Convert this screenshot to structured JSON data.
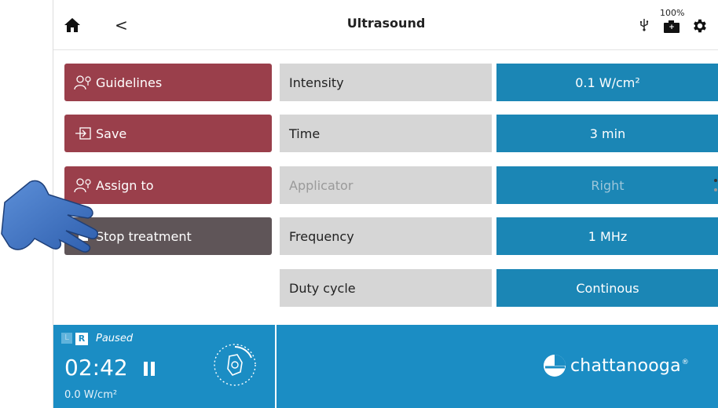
{
  "header": {
    "title": "Ultrasound",
    "back_glyph": "<",
    "battery_percent": "100%",
    "icons": [
      "home-icon",
      "back-icon",
      "usb-icon",
      "battery-icon",
      "gear-icon"
    ]
  },
  "actions": {
    "guidelines": "Guidelines",
    "save": "Save",
    "assign_to": "Assign to",
    "stop_treatment": "Stop treatment"
  },
  "parameters": [
    {
      "label": "Intensity",
      "value": "0.1 W/cm²",
      "enabled": true
    },
    {
      "label": "Time",
      "value": "3 min",
      "enabled": true
    },
    {
      "label": "Applicator",
      "value": "Right",
      "enabled": false
    },
    {
      "label": "Frequency",
      "value": "1 MHz",
      "enabled": true
    },
    {
      "label": "Duty cycle",
      "value": "Continous",
      "enabled": true
    }
  ],
  "treatment": {
    "left_channel": "L",
    "right_channel": "R",
    "status": "Paused",
    "timer": "02:42",
    "power": "0.0 W/cm²"
  },
  "brand": {
    "name": "chattanooga",
    "registered": "®"
  },
  "colors": {
    "action_red": "#9a3f4b",
    "action_dark": "#5f5558",
    "param_label_bg": "#d6d6d6",
    "param_value_bg": "#1b86b5",
    "footer_bg": "#1b8dc4"
  }
}
